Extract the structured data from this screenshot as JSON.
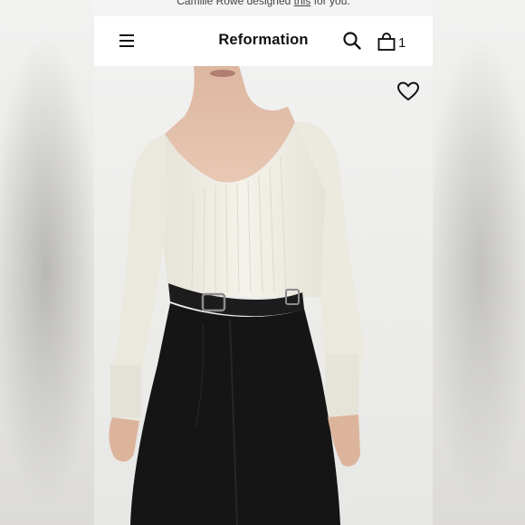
{
  "top_banner": {
    "text_before": "Camille Rowe designed ",
    "link": "this",
    "text_after": " for you."
  },
  "navbar": {
    "brand": "Reformation",
    "bag_count": "1",
    "icons": [
      "menu-icon",
      "search-icon",
      "bag-icon"
    ]
  },
  "product": {
    "image": "model-wearing-white-ribbed-sweater-black-trousers",
    "favorite_icon": "heart-icon"
  },
  "colors": {
    "background": "#e9e8e6",
    "frame": "#ffffff",
    "text": "#111111",
    "sweater": "#f1efe6",
    "trousers": "#141414"
  }
}
